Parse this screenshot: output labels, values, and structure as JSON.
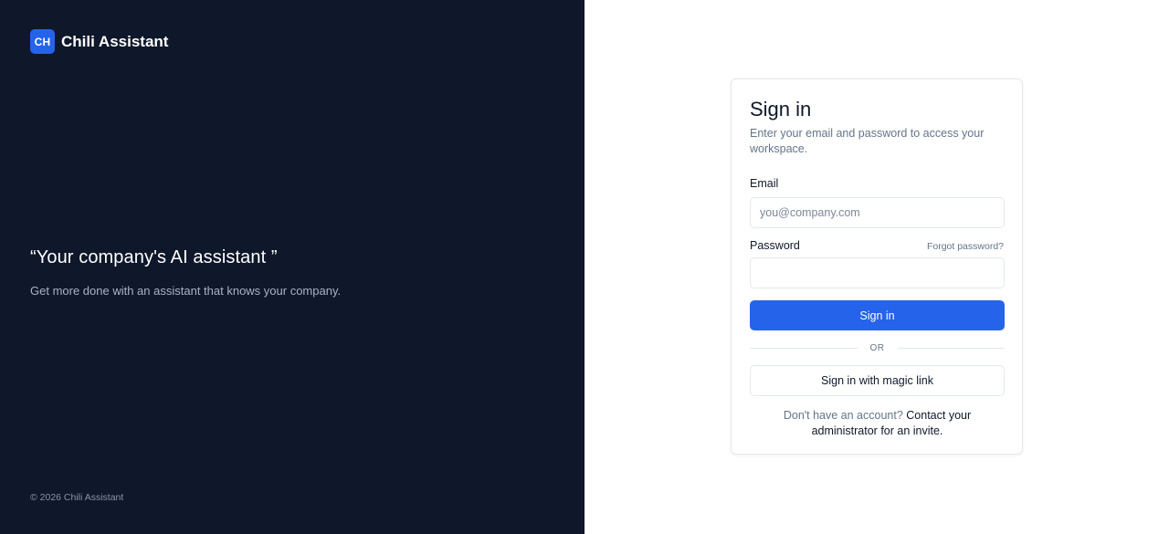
{
  "brand": {
    "logo_text": "CH",
    "name": "Chili Assistant",
    "accent_color": "#2563eb"
  },
  "hero": {
    "quote": "“Your company's AI assistant ”",
    "tagline": "Get more done with an assistant that knows your company."
  },
  "footer": {
    "copyright": "© 2026 Chili Assistant"
  },
  "signin": {
    "title": "Sign in",
    "subtitle": "Enter your email and password to access your workspace.",
    "email_label": "Email",
    "email_placeholder": "you@company.com",
    "email_value": "",
    "password_label": "Password",
    "password_value": "",
    "forgot_label": "Forgot password?",
    "submit_label": "Sign in",
    "divider_label": "OR",
    "magic_link_label": "Sign in with magic link",
    "no_account_text": "Don't have an account?",
    "contact_link_text": "Contact your administrator for an invite."
  },
  "colors": {
    "left_panel_bg": "#0f172a",
    "primary_button": "#2563eb"
  }
}
